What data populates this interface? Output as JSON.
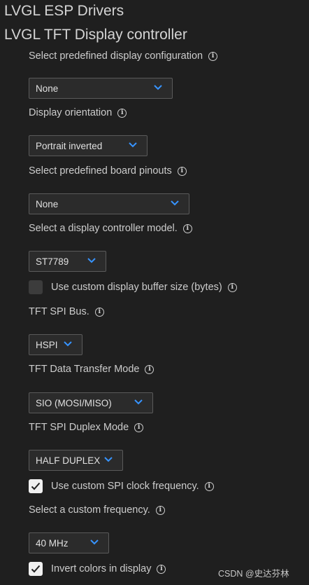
{
  "header": {
    "title": "LVGL ESP Drivers",
    "subtitle": "LVGL TFT Display controller"
  },
  "fields": {
    "predefined_config": {
      "label": "Select predefined display configuration",
      "value": "None"
    },
    "orientation": {
      "label": "Display orientation",
      "value": "Portrait inverted"
    },
    "board_pinouts": {
      "label": "Select predefined board pinouts",
      "value": "None"
    },
    "controller_model": {
      "label": "Select a display controller model.",
      "value": "ST7789"
    },
    "custom_buffer": {
      "label": "Use custom display buffer size (bytes)",
      "checked": false
    },
    "spi_bus": {
      "label": "TFT SPI Bus.",
      "value": "HSPI"
    },
    "transfer_mode": {
      "label": "TFT Data Transfer Mode",
      "value": "SIO (MOSI/MISO)"
    },
    "duplex_mode": {
      "label": "TFT SPI Duplex Mode",
      "value": "HALF DUPLEX"
    },
    "custom_spi_clock": {
      "label": "Use custom SPI clock frequency.",
      "checked": true
    },
    "custom_frequency": {
      "label": "Select a custom frequency.",
      "value": "40 MHz"
    },
    "invert_colors": {
      "label": "Invert colors in display",
      "checked": true
    }
  },
  "watermark": "CSDN @史达芬林",
  "colors": {
    "accent": "#3794ff",
    "background": "#1f1f1f",
    "control": "#2b2b2b"
  },
  "icons": {
    "info": "info-icon",
    "chevron": "chevron-down-icon",
    "check": "check-icon"
  }
}
